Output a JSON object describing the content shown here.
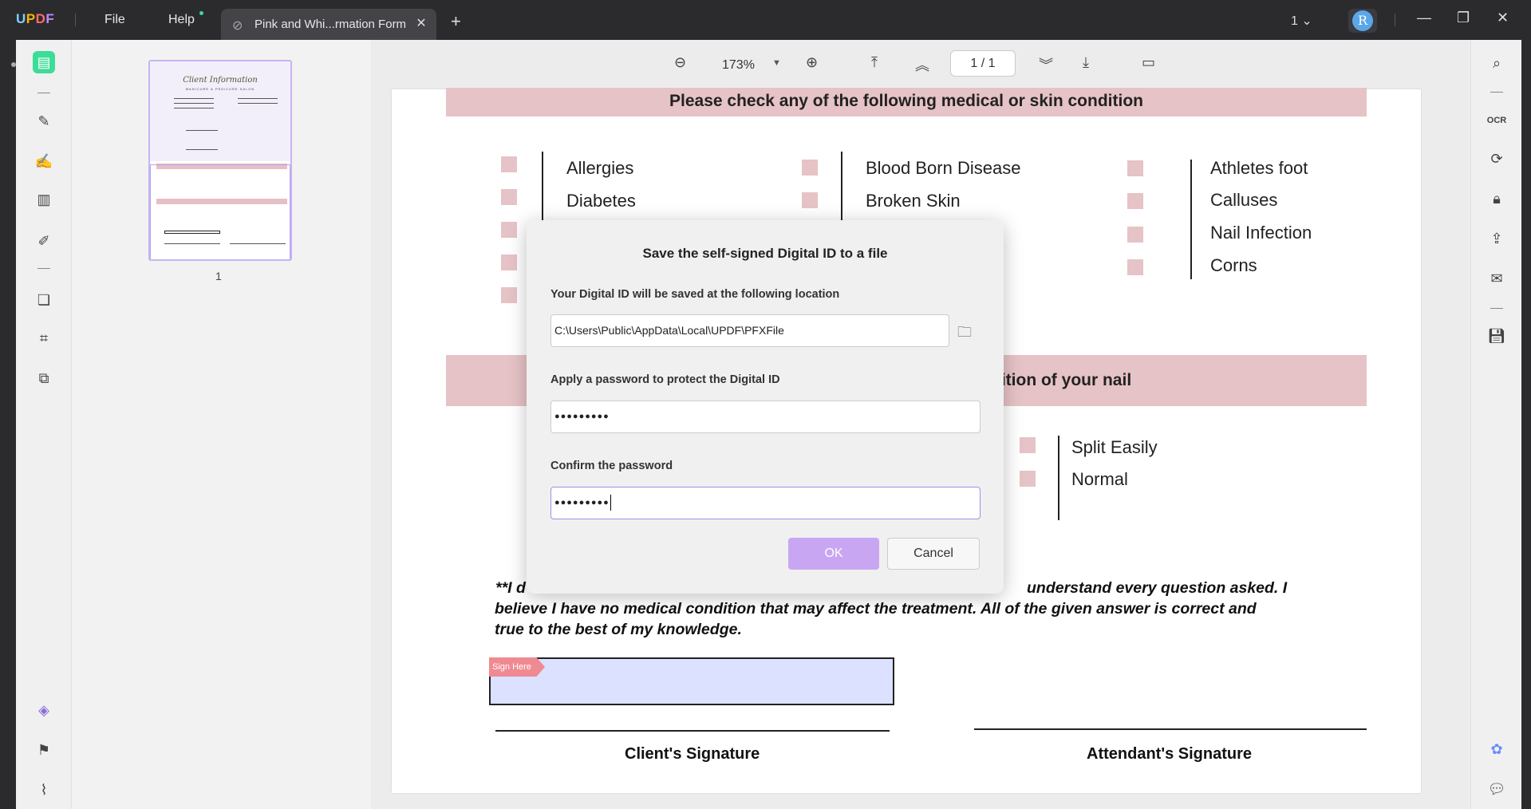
{
  "app": {
    "logo": "UPDF",
    "menu": {
      "file": "File",
      "help": "Help"
    },
    "tab": {
      "title": "Pink and Whi...rmation Form",
      "close": "✕"
    },
    "new_tab": "+",
    "window_count": "1",
    "user_initial": "R",
    "window_controls": {
      "minimize": "—",
      "restore": "❐",
      "close": "✕"
    }
  },
  "thumbnails": {
    "page_label": "1",
    "title": "Client Information",
    "subtitle": "MANICURE & PEDICURE SALON"
  },
  "toolbar": {
    "zoom": "173%",
    "page_current": "1",
    "page_sep": "/",
    "page_total": "1"
  },
  "document": {
    "section1_title": "Please check any of the following medical or skin condition",
    "col1": [
      "Allergies",
      "Diabetes"
    ],
    "col2": [
      "Blood Born Disease",
      "Broken Skin"
    ],
    "col3": [
      "Athletes foot",
      "Calluses",
      "Nail Infection",
      "Corns"
    ],
    "section2_title": "dition of your nail",
    "nail_conditions": [
      "Split Easily",
      "Normal"
    ],
    "statement_line1": "**I d",
    "statement_line1_end": "understand every question asked. I",
    "statement_line2": "believe I have no medical condition that may affect the treatment. All of the given answer is correct and",
    "statement_line3": "true to the best of my knowledge.",
    "sign_here": "Sign Here",
    "client_signature": "Client's Signature",
    "attendant_signature": "Attendant's Signature"
  },
  "dialog": {
    "title": "Save the self-signed Digital ID to a file",
    "location_label": "Your Digital ID will be saved at the following location",
    "location_value": "C:\\Users\\Public\\AppData\\Local\\UPDF\\PFXFile",
    "password_label": "Apply a password to protect the Digital ID",
    "password_value": "●●●●●●●●●",
    "confirm_label": "Confirm the password",
    "confirm_value": "●●●●●●●●●",
    "ok": "OK",
    "cancel": "Cancel"
  },
  "colors": {
    "accent_green": "#3ddc97",
    "ok_purple": "#c9a6f2",
    "band_pink": "#e6c3c6"
  },
  "icons": {
    "left_rail": [
      "reader-icon",
      "highlighter-icon",
      "edit-text-icon",
      "page-layout-icon",
      "form-edit-icon",
      "organize-pages-icon",
      "crop-icon",
      "compare-icon",
      "layers-icon",
      "bookmark-icon",
      "attachment-icon"
    ],
    "right_rail": [
      "search-icon",
      "ocr-icon",
      "convert-icon",
      "protect-icon",
      "share-icon",
      "email-icon",
      "save-icon",
      "ai-icon",
      "comment-icon"
    ]
  }
}
